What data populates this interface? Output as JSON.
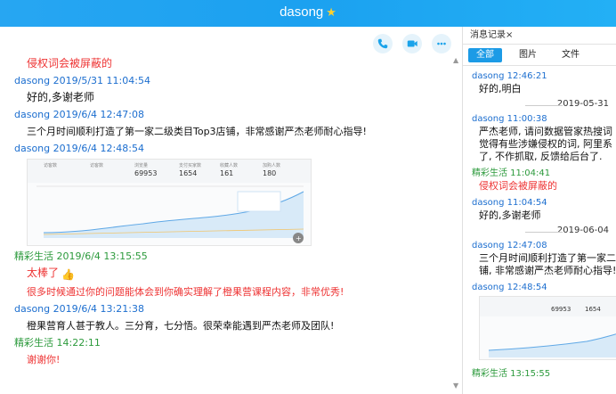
{
  "window": {
    "title": "dasong",
    "star": "★"
  },
  "chat": {
    "icons": [
      "phone-icon",
      "video-icon",
      "more-icon"
    ],
    "messages": [
      {
        "type": "text",
        "color": "red",
        "text": "侵权词会被屏蔽的"
      },
      {
        "sender": "dasong 2019/5/31 11:04:54",
        "text": "好的,多谢老师"
      },
      {
        "sender": "dasong 2019/6/4 12:47:08",
        "text": "三个月时间顺利打造了第一家二级类目Top3店铺，非常感谢严杰老师耐心指导!"
      },
      {
        "sender": "dasong 2019/6/4 12:48:54",
        "image": "screenshot"
      },
      {
        "sender": "精彩生活 2019/6/4 13:15:55",
        "text1": "太棒了",
        "text2": "很多时候通过你的问题能体会到你确实理解了橙果营课程内容，非常优秀!"
      },
      {
        "sender": "dasong 2019/6/4 13:21:38",
        "text": "橙果营育人甚于教人。三分育，七分悟。很荣幸能遇到严杰老师及团队!"
      },
      {
        "sender": "精彩生活  14:22:11",
        "text": "谢谢你!"
      }
    ],
    "shot_stats": [
      {
        "label": "访客数",
        "value": ""
      },
      {
        "label": "访客数",
        "value": ""
      },
      {
        "label": "浏览量",
        "value": "69953"
      },
      {
        "label": "支付买家数",
        "value": "1654"
      },
      {
        "label": "收藏人数",
        "value": "161"
      },
      {
        "label": "加购人数",
        "value": "180"
      }
    ]
  },
  "panel": {
    "tab": "消息记录",
    "close": "×",
    "filters": [
      "全部",
      "图片",
      "文件"
    ],
    "entries": [
      {
        "kind": "msg",
        "name": "dasong 12:46:21",
        "color": "blue",
        "text": "好的,明白"
      },
      {
        "kind": "date",
        "text": "2019-05-31"
      },
      {
        "kind": "msg",
        "name": "dasong 11:00:38",
        "color": "blue",
        "lines": [
          "严杰老师, 请问数据管家热搜词",
          "觉得有些涉嫌侵权的词, 阿里系",
          "了, 不作抓取, 反馈给后台了."
        ]
      },
      {
        "kind": "msg",
        "name": "精彩生活 11:04:41",
        "color": "green",
        "text": "侵权词会被屏蔽的",
        "red": true
      },
      {
        "kind": "msg",
        "name": "dasong 11:04:54",
        "color": "blue",
        "text": "好的,多谢老师"
      },
      {
        "kind": "date",
        "text": "2019-06-04"
      },
      {
        "kind": "msg",
        "name": "dasong 12:47:08",
        "color": "blue",
        "lines": [
          "三个月时间顺利打造了第一家二级",
          "铺, 非常感谢严杰老师耐心指导!"
        ]
      },
      {
        "kind": "msg",
        "name": "dasong 12:48:54",
        "color": "blue",
        "image": true
      },
      {
        "kind": "msg",
        "name": "精彩生活 13:15:55",
        "color": "green"
      }
    ],
    "shot_values": [
      "69953",
      "1654"
    ]
  }
}
